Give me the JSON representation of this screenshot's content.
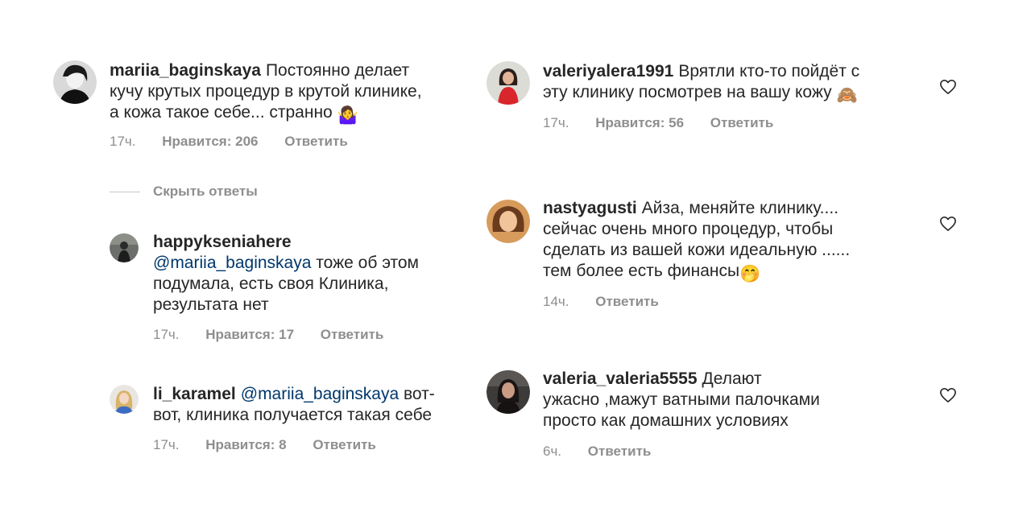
{
  "left_column": {
    "main_comment": {
      "username": "mariia_baginskaya",
      "text_line1": "Постоянно делает",
      "text_line2": "кучу крутых процедур в крутой клинике,",
      "text_line3": "а кожа такое себе... странно",
      "emoji": "🤷‍♀️",
      "time": "17ч.",
      "likes": "Нравится: 206",
      "reply": "Ответить"
    },
    "hide_replies": "Скрыть ответы",
    "replies": [
      {
        "username": "happykseniahere",
        "mention": "@mariia_baginskaya",
        "text_line1_rest": "тоже об этом",
        "text_line2": "подумала, есть своя Клиника,",
        "text_line3": "результата нет",
        "time": "17ч.",
        "likes": "Нравится: 17",
        "reply": "Ответить"
      },
      {
        "username": "li_karamel",
        "mention": "@mariia_baginskaya",
        "text_line1_rest": "вот-",
        "text_line2": "вот, клиника получается такая себе",
        "time": "17ч.",
        "likes": "Нравится: 8",
        "reply": "Ответить"
      }
    ]
  },
  "right_column": [
    {
      "username": "valeriyalera1991",
      "text_line1": "Врятли кто-то пойдёт с",
      "text_line2": "эту клинику посмотрев на вашу кожу",
      "emoji": "🙈",
      "time": "17ч.",
      "likes": "Нравится: 56",
      "reply": "Ответить"
    },
    {
      "username": "nastyagusti",
      "text_line1": "Айза, меняйте клинику....",
      "text_line2": "сейчас очень много процедур, чтобы",
      "text_line3": "сделать из вашей кожи идеальную ......",
      "text_line4": "тем более есть финансы",
      "emoji": "🤭",
      "time": "14ч.",
      "reply": "Ответить"
    },
    {
      "username": "valeria_valeria5555",
      "text_line1": "Делают",
      "text_line2": "ужасно ,мажут ватными палочками",
      "text_line3": "просто как домашних условиях",
      "time": "6ч.",
      "reply": "Ответить"
    }
  ]
}
